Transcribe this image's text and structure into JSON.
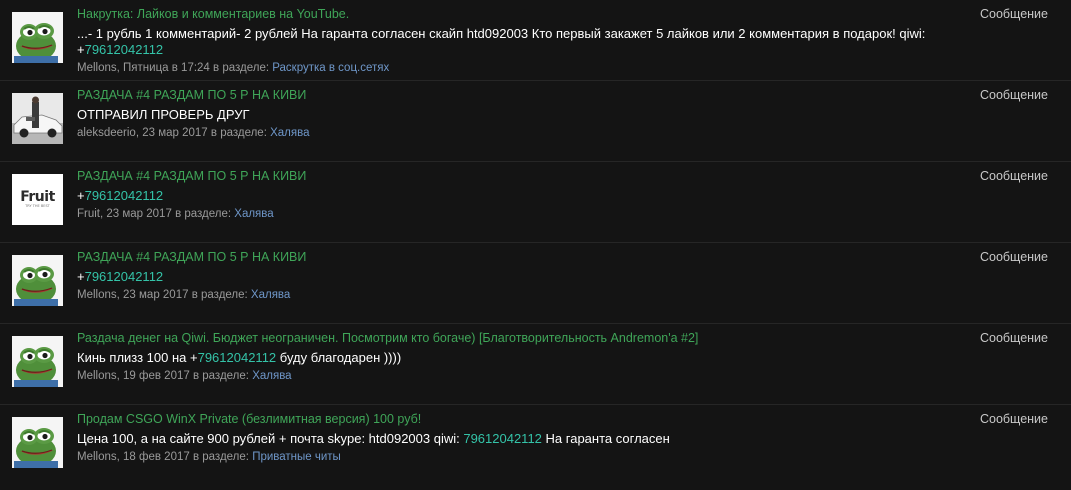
{
  "results": [
    {
      "avatar": "frog-avatar",
      "title": "Накрутка: Лайков и комментариев на YouTube.",
      "snippet": [
        {
          "t": "...- 1 рубль 1 комментарий- 2 рублей На гаранта согласен скайп htd092003 Кто первый закажет 5 лайков или 2 комментария в подарок! qiwi: +",
          "hl": false
        },
        {
          "t": "79612042112",
          "hl": true
        }
      ],
      "author": "Mellons",
      "date": "Пятница в 17:24",
      "section_prefix": "в разделе:",
      "section": "Раскрутка в соц.сетях",
      "type": "Сообщение"
    },
    {
      "avatar": "car-photo-avatar",
      "title": "РАЗДАЧА #4 РАЗДАМ ПО 5 Р НА КИВИ",
      "snippet": [
        {
          "t": "ОТПРАВИЛ ПРОВЕРЬ ДРУГ",
          "hl": false
        }
      ],
      "author": "aleksdeerio",
      "date": "23 мар 2017",
      "section_prefix": "в разделе:",
      "section": "Халява",
      "type": "Сообщение"
    },
    {
      "avatar": "fruit-logo-avatar",
      "avatar_text": "Fruit",
      "avatar_subtext": "TRY THE BEST",
      "title": "РАЗДАЧА #4 РАЗДАМ ПО 5 Р НА КИВИ",
      "snippet": [
        {
          "t": "+",
          "hl": false
        },
        {
          "t": "79612042112",
          "hl": true
        }
      ],
      "author": "Fruit",
      "date": "23 мар 2017",
      "section_prefix": "в разделе:",
      "section": "Халява",
      "type": "Сообщение"
    },
    {
      "avatar": "frog-avatar",
      "title": "РАЗДАЧА #4 РАЗДАМ ПО 5 Р НА КИВИ",
      "snippet": [
        {
          "t": "+",
          "hl": false
        },
        {
          "t": "79612042112",
          "hl": true
        }
      ],
      "author": "Mellons",
      "date": "23 мар 2017",
      "section_prefix": "в разделе:",
      "section": "Халява",
      "type": "Сообщение"
    },
    {
      "avatar": "frog-avatar",
      "title": "Раздача денег на Qiwi. Бюджет неограничен. Посмотрим кто богаче) [Благотворительность Andremon'a #2]",
      "snippet": [
        {
          "t": "Кинь плизз 100 на +",
          "hl": false
        },
        {
          "t": "79612042112",
          "hl": true
        },
        {
          "t": " буду благодарен ))))",
          "hl": false
        }
      ],
      "author": "Mellons",
      "date": "19 фев 2017",
      "section_prefix": "в разделе:",
      "section": "Халява",
      "type": "Сообщение"
    },
    {
      "avatar": "frog-avatar",
      "title": "Продам CSGO WinX Private (безлимитная версия) 100 руб!",
      "snippet": [
        {
          "t": "Цена 100, а на сайте 900 рублей + почта skype: htd092003 qiwi: ",
          "hl": false
        },
        {
          "t": "79612042112",
          "hl": true
        },
        {
          "t": " На гаранта согласен",
          "hl": false
        }
      ],
      "author": "Mellons",
      "date": "18 фев 2017",
      "section_prefix": "в разделе:",
      "section": "Приватные читы",
      "type": "Сообщение"
    }
  ],
  "colors": {
    "background": "#141414",
    "title_green": "#3fa558",
    "phone_highlight": "#34c3a8",
    "section_link": "#6f97c9",
    "meta_gray": "#9a9a9a"
  }
}
